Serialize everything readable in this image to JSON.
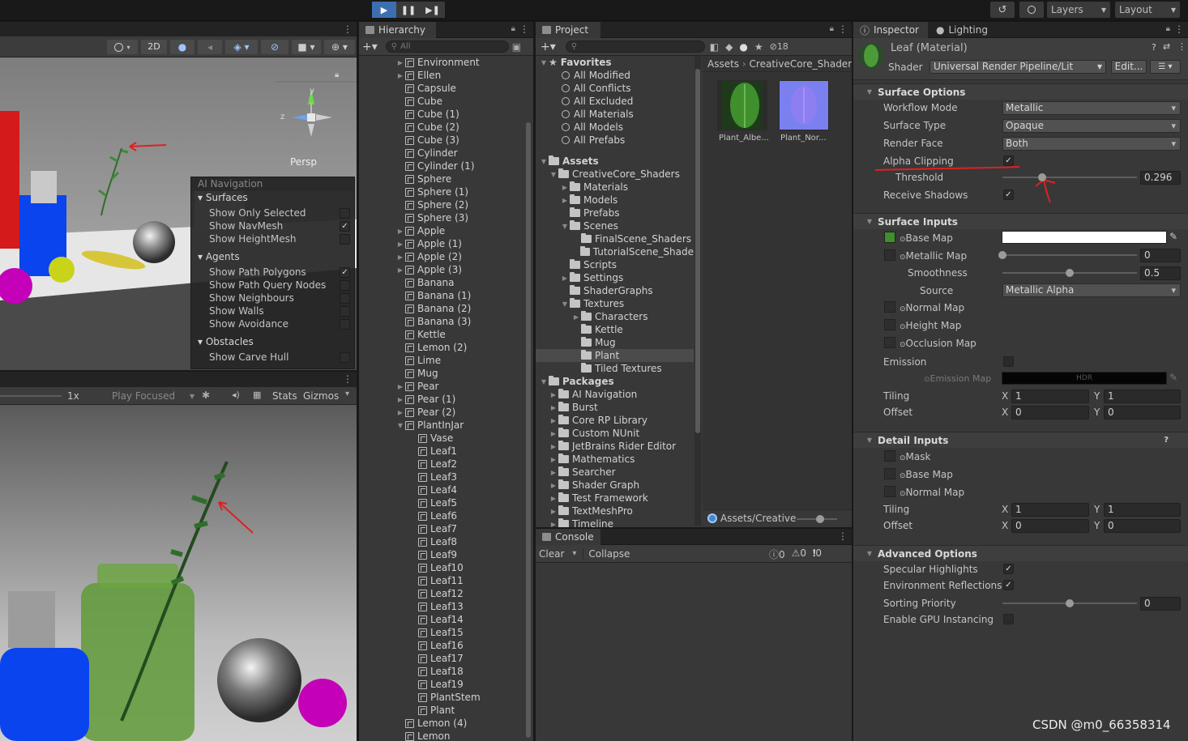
{
  "topbar": {
    "play_icon": "play-icon",
    "pause_icon": "pause-icon",
    "step_icon": "step-icon",
    "history_icon": "history-icon",
    "search_icon": "search-icon",
    "layers": "Layers",
    "layout": "Layout"
  },
  "scene_toolbar": {
    "mode_2d": "2D"
  },
  "gizmo": {
    "y": "y",
    "z": "z",
    "persp": "Persp"
  },
  "ai_navigation": {
    "title": "AI Navigation",
    "surfaces": "Surfaces",
    "show_only_selected": "Show Only Selected",
    "show_navmesh": "Show NavMesh",
    "show_heightmesh": "Show HeightMesh",
    "agents": "Agents",
    "show_path_polygons": "Show Path Polygons",
    "show_path_query_nodes": "Show Path Query Nodes",
    "show_neighbours": "Show Neighbours",
    "show_walls": "Show Walls",
    "show_avoidance": "Show Avoidance",
    "obstacles": "Obstacles",
    "show_carve_hull": "Show Carve Hull"
  },
  "game_toolbar": {
    "scale": "1x",
    "play_focused": "Play Focused",
    "stats": "Stats",
    "gizmos": "Gizmos"
  },
  "hierarchy": {
    "tab": "Hierarchy",
    "search_placeholder": "All",
    "items": [
      "Environment",
      "Ellen",
      "Capsule",
      "Cube",
      "Cube (1)",
      "Cube (2)",
      "Cube (3)",
      "Cylinder",
      "Cylinder (1)",
      "Sphere",
      "Sphere (1)",
      "Sphere (2)",
      "Sphere (3)",
      "Apple",
      "Apple (1)",
      "Apple (2)",
      "Apple (3)",
      "Banana",
      "Banana (1)",
      "Banana (2)",
      "Banana (3)",
      "Kettle",
      "Lemon (2)",
      "Lime",
      "Mug",
      "Pear",
      "Pear (1)",
      "Pear (2)",
      "PlantInJar"
    ],
    "children": [
      "Vase",
      "Leaf1",
      "Leaf2",
      "Leaf3",
      "Leaf4",
      "Leaf5",
      "Leaf6",
      "Leaf7",
      "Leaf8",
      "Leaf9",
      "Leaf10",
      "Leaf11",
      "Leaf12",
      "Leaf13",
      "Leaf14",
      "Leaf15",
      "Leaf16",
      "Leaf17",
      "Leaf18",
      "Leaf19",
      "PlantStem",
      "Plant"
    ],
    "after": [
      "Lemon (4)",
      "Lemon"
    ]
  },
  "project": {
    "tab": "Project",
    "hidden_count": "18",
    "favorites": "Favorites",
    "favorites_items": [
      "All Modified",
      "All Conflicts",
      "All Excluded",
      "All Materials",
      "All Models",
      "All Prefabs"
    ],
    "assets": "Assets",
    "creative": "CreativeCore_Shaders",
    "creative_items": [
      "Materials",
      "Models",
      "Prefabs",
      "Scenes"
    ],
    "scenes_items": [
      "FinalScene_Shaders",
      "TutorialScene_Shade"
    ],
    "creative_items2": [
      "Scripts",
      "Settings",
      "ShaderGraphs",
      "Textures"
    ],
    "textures_items": [
      "Characters",
      "Kettle",
      "Mug",
      "Plant"
    ],
    "tiled": "Tiled Textures",
    "packages": "Packages",
    "packages_items": [
      "AI Navigation",
      "Burst",
      "Core RP Library",
      "Custom NUnit",
      "JetBrains Rider Editor",
      "Mathematics",
      "Searcher",
      "Shader Graph",
      "Test Framework",
      "TextMeshPro",
      "Timeline"
    ],
    "breadcrumb_root": "Assets",
    "breadcrumb_sep": "›",
    "breadcrumb_leaf": "CreativeCore_Shaders",
    "asset1": "Plant_Albe...",
    "asset2": "Plant_Nor...",
    "footer_path": "Assets/Creative"
  },
  "console": {
    "tab": "Console",
    "clear": "Clear",
    "collapse": "Collapse",
    "log_count": "0",
    "warn_count": "0",
    "err_count": "0"
  },
  "inspector": {
    "tab": "Inspector",
    "tab2": "Lighting",
    "material_name": "Leaf (Material)",
    "shader_label": "Shader",
    "shader_value": "Universal Render Pipeline/Lit",
    "edit": "Edit...",
    "surface_options": "Surface Options",
    "workflow_mode": "Workflow Mode",
    "workflow_value": "Metallic",
    "surface_type": "Surface Type",
    "surface_value": "Opaque",
    "render_face": "Render Face",
    "render_face_value": "Both",
    "alpha_clipping": "Alpha Clipping",
    "threshold": "Threshold",
    "threshold_value": "0.296",
    "threshold_fraction": 0.296,
    "receive_shadows": "Receive Shadows",
    "surface_inputs": "Surface Inputs",
    "base_map": "Base Map",
    "metallic_map": "Metallic Map",
    "metallic_value": "0",
    "metallic_fraction": 0,
    "smoothness": "Smoothness",
    "smoothness_value": "0.5",
    "smoothness_fraction": 0.5,
    "source": "Source",
    "source_value": "Metallic Alpha",
    "normal_map": "Normal Map",
    "height_map": "Height Map",
    "occlusion_map": "Occlusion Map",
    "emission": "Emission",
    "emission_map": "Emission Map",
    "hdr": "HDR",
    "tiling": "Tiling",
    "offset": "Offset",
    "x": "X",
    "y": "Y",
    "tiling_x": "1",
    "tiling_y": "1",
    "offset_x": "0",
    "offset_y": "0",
    "detail_inputs": "Detail Inputs",
    "mask": "Mask",
    "detail_base_map": "Base Map",
    "detail_normal_map": "Normal Map",
    "detail_tiling_x": "1",
    "detail_tiling_y": "1",
    "detail_offset_x": "0",
    "detail_offset_y": "0",
    "advanced_options": "Advanced Options",
    "specular_highlights": "Specular Highlights",
    "environment_reflections": "Environment Reflections",
    "sorting_priority": "Sorting Priority",
    "sorting_value": "0",
    "sorting_fraction": 0.5,
    "gpu_instancing": "Enable GPU Instancing"
  },
  "watermark": "CSDN @m0_66358314",
  "colors": {
    "accent": "#3d6fb0",
    "annotation": "#e02020",
    "panel": "#383838"
  }
}
